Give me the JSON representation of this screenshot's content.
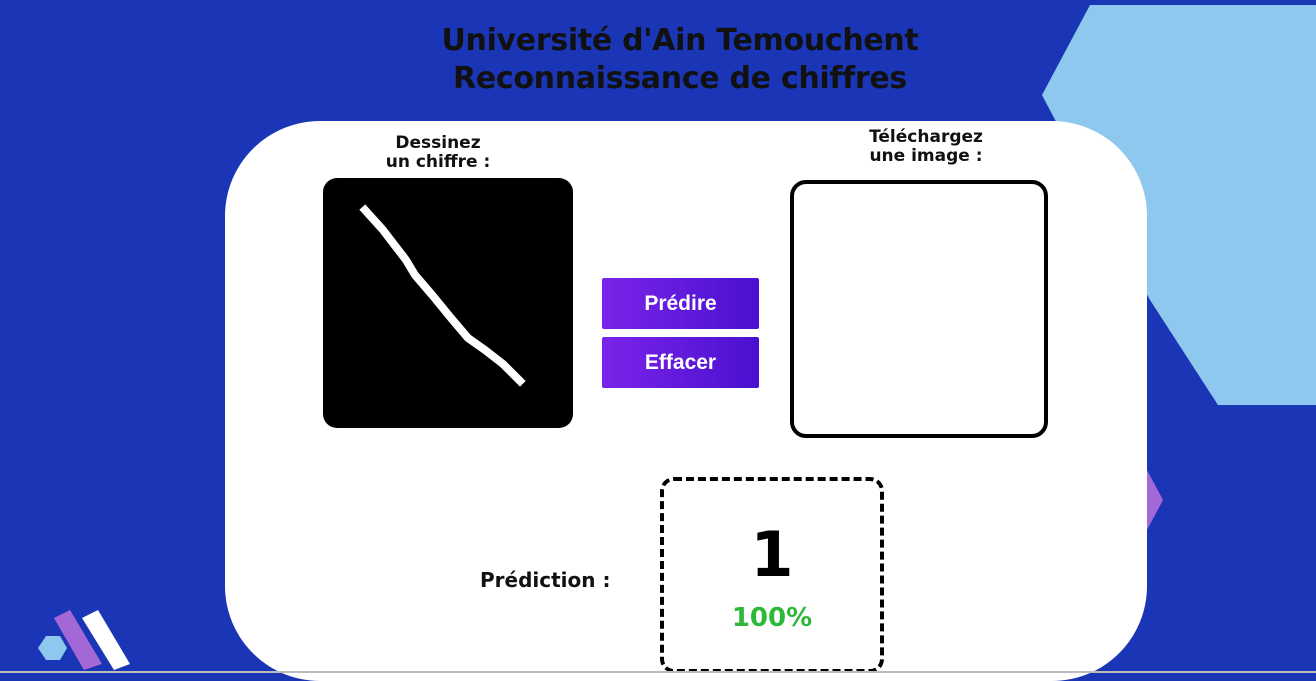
{
  "header": {
    "line1": "Université d'Ain Temouchent",
    "line2": "Reconnaissance de chiffres"
  },
  "draw": {
    "label_line1": "Dessinez",
    "label_line2": "un chiffre :"
  },
  "upload": {
    "label_line1": "Téléchargez",
    "label_line2": "une image :"
  },
  "buttons": {
    "predict": "Prédire",
    "clear": "Effacer"
  },
  "prediction": {
    "label": "Prédiction :",
    "digit": "1",
    "confidence": "100%"
  },
  "colors": {
    "background": "#1a35b5",
    "button_gradient_start": "#7a24e8",
    "button_gradient_end": "#4a10d0",
    "confidence": "#2db83a",
    "deco_light_blue": "#8fc8ef",
    "deco_purple": "#a468d6"
  }
}
